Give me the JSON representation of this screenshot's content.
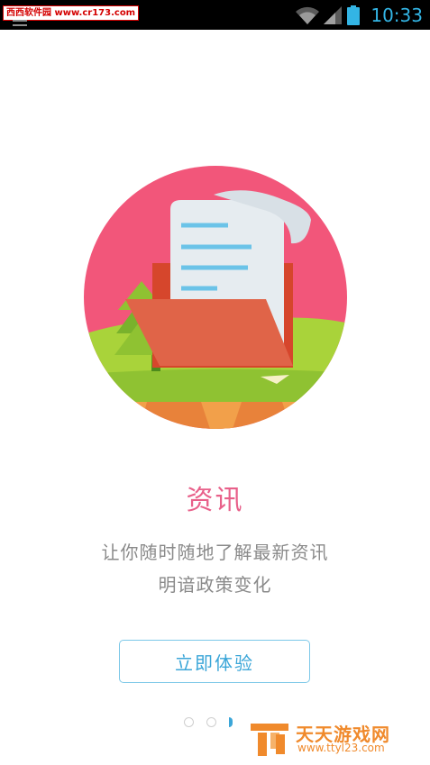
{
  "status_bar": {
    "time": "10:33",
    "watermark": "西西软件园 www.cr173.com",
    "icons": [
      "wifi-icon",
      "signal-icon",
      "battery-icon"
    ],
    "accent": "#33b5e5"
  },
  "onboarding": {
    "title": "资讯",
    "description_line1": "让你随时随地了解最新资讯",
    "description_line2": "明谙政策变化",
    "cta_label": "立即体验",
    "page_indicator": {
      "count": 3,
      "active": 3
    },
    "illustration": "news-document-folder-illustration"
  },
  "branding": {
    "name": "天天游戏网",
    "url": "www.ttyl23.com",
    "icon": "ttyl-logo-icon"
  },
  "colors": {
    "title": "#e8608a",
    "cta_border": "#7cc8e8",
    "cta_text": "#3ba6d8",
    "brand": "#f08a2c",
    "circle_bg": "#f2567a"
  }
}
